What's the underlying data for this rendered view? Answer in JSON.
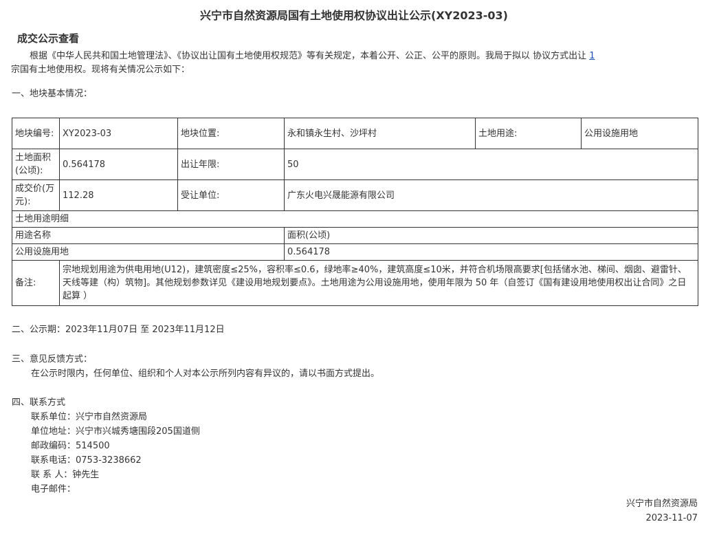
{
  "title": "兴宁市自然资源局国有土地使用权协议出让公示(XY2023-03)",
  "subtitle": "成交公示查看",
  "intro": {
    "before": "根据《中华人民共和国土地管理法》、《协议出让国有土地使用权规范》等有关规定，本着公开、公正、公平的原则。我局于拟以 协议方式出让 ",
    "count": "1",
    "after": "宗国有土地使用权。现将有关情况公示如下："
  },
  "section1": "一、地块基本情况：",
  "table": {
    "parcel_no_label": "地块编号:",
    "parcel_no": "XY2023-03",
    "location_label": "地块位置:",
    "location": "永和镇永生村、沙坪村",
    "use_label": "土地用途:",
    "use": "公用设施用地",
    "area_label": "土地面积(公顷):",
    "area": "0.564178",
    "term_label": "出让年限:",
    "term": "50",
    "price_label": "成交价(万元):",
    "price": "112.28",
    "grantee_label": "受让单位:",
    "grantee": "广东火电兴晟能源有限公司",
    "detail_header": "土地用途明细",
    "use_name_header": "用途名称",
    "use_area_header": "面积(公顷)",
    "detail_use": "公用设施用地",
    "detail_area": "0.564178",
    "remark_label": "备注:",
    "remark": "宗地规划用途为供电用地(U12)，建筑密度≤25%，容积率≤0.6，绿地率≥40%，建筑高度≤10米，并符合机场限高要求[包括储水池、梯间、烟囱、避雷针、天线等建（构）筑物]。其他规划参数详见《建设用地规划要点》。土地用途为公用设施用地，使用年限为 50 年（自签订《国有建设用地使用权出让合同》之日起算 ）"
  },
  "section2": "二、公示期：2023年11月07日 至 2023年11月12日",
  "section3": {
    "heading": "三、意见反馈方式：",
    "text": "在公示时限内，任何单位、组织和个人对本公示所列内容有异议的，请以书面方式提出。"
  },
  "section4": {
    "heading": "四、联系方式",
    "unit": "联系单位：兴宁市自然资源局",
    "address": "单位地址：兴宁市兴城秀塘围段205国道侧",
    "postcode": "邮政编码：514500",
    "phone": "联系电话：0753-3238662",
    "contact": "联 系 人：钟先生",
    "email": "电子邮件："
  },
  "signature": {
    "org": "兴宁市自然资源局",
    "date": "2023-11-07"
  }
}
